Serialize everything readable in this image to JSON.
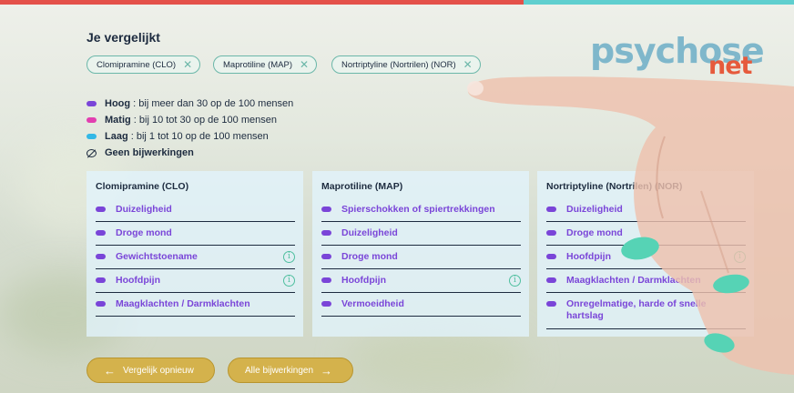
{
  "title": "Je vergelijkt",
  "chips": [
    {
      "label": "Clomipramine (CLO)"
    },
    {
      "label": "Maprotiline (MAP)"
    },
    {
      "label": "Nortriptyline (Nortrilen) (NOR)"
    }
  ],
  "chip_remove_glyph": "✕",
  "legend": [
    {
      "level": "Hoog",
      "text": " : bij meer dan 30 op de 100 mensen"
    },
    {
      "level": "Matig",
      "text": " : bij 10 tot 30 op de 100 mensen"
    },
    {
      "level": "Laag",
      "text": " : bij 1 tot 10 op de 100 mensen"
    },
    {
      "level": "Geen bijwerkingen",
      "text": ""
    }
  ],
  "panels": [
    {
      "title": "Clomipramine (CLO)",
      "items": [
        {
          "label": "Duizeligheid",
          "info": false
        },
        {
          "label": "Droge mond",
          "info": false
        },
        {
          "label": "Gewichtstoename",
          "info": true
        },
        {
          "label": "Hoofdpijn",
          "info": true
        },
        {
          "label": "Maagklachten / Darmklachten",
          "info": false
        }
      ]
    },
    {
      "title": "Maprotiline (MAP)",
      "items": [
        {
          "label": "Spierschokken of spiertrekkingen",
          "info": false
        },
        {
          "label": "Duizeligheid",
          "info": false
        },
        {
          "label": "Droge mond",
          "info": false
        },
        {
          "label": "Hoofdpijn",
          "info": true
        },
        {
          "label": "Vermoeidheid",
          "info": false
        }
      ]
    },
    {
      "title": "Nortriptyline (Nortrilen) (NOR)",
      "items": [
        {
          "label": "Duizeligheid",
          "info": false
        },
        {
          "label": "Droge mond",
          "info": false
        },
        {
          "label": "Hoofdpijn",
          "info": true
        },
        {
          "label": "Maagklachten / Darmklachten",
          "info": false
        },
        {
          "label": "Onregelmatige, harde of snelle hartslag",
          "info": false
        }
      ]
    }
  ],
  "info_glyph": "i",
  "buttons": {
    "compare_again": "Vergelijk opnieuw",
    "all_side_effects": "Alle bijwerkingen",
    "back_arrow": "←",
    "forward_arrow": "→"
  },
  "logo": {
    "part1": "psychose",
    "part2": "net"
  },
  "colors": {
    "accent_red": "#e4514a",
    "accent_teal": "#5fcfcf",
    "hoog": "#7a45d8",
    "matig": "#e23fb0",
    "laag": "#33b8e6",
    "button": "#d4b24c"
  }
}
